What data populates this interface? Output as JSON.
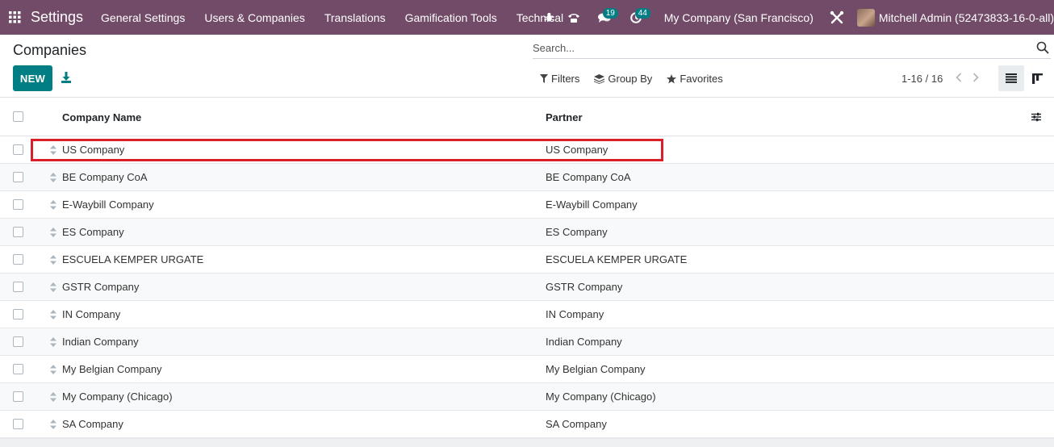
{
  "navbar": {
    "app_name": "Settings",
    "menu": [
      "General Settings",
      "Users & Companies",
      "Translations",
      "Gamification Tools",
      "Technical"
    ],
    "messages_badge": "19",
    "activities_badge": "44",
    "company": "My Company (San Francisco)",
    "user": "Mitchell Admin (52473833-16-0-all)",
    "icons": [
      "apps-grid-icon",
      "bug-icon",
      "phone-icon",
      "chat-icon",
      "clock-icon",
      "tools-icon",
      "avatar"
    ]
  },
  "control_panel": {
    "breadcrumb": "Companies",
    "search_placeholder": "Search...",
    "new_label": "NEW",
    "filters_label": "Filters",
    "group_by_label": "Group By",
    "favorites_label": "Favorites",
    "pager": "1-16 / 16"
  },
  "list": {
    "columns": {
      "name": "Company Name",
      "partner": "Partner"
    },
    "rows": [
      {
        "name": "US Company",
        "partner": "US Company"
      },
      {
        "name": "BE Company CoA",
        "partner": "BE Company CoA"
      },
      {
        "name": "E-Waybill Company",
        "partner": "E-Waybill Company"
      },
      {
        "name": "ES Company",
        "partner": "ES Company"
      },
      {
        "name": "ESCUELA KEMPER URGATE",
        "partner": "ESCUELA KEMPER URGATE"
      },
      {
        "name": "GSTR Company",
        "partner": "GSTR Company"
      },
      {
        "name": "IN Company",
        "partner": "IN Company"
      },
      {
        "name": "Indian Company",
        "partner": "Indian Company"
      },
      {
        "name": "My Belgian Company",
        "partner": "My Belgian Company"
      },
      {
        "name": "My Company (Chicago)",
        "partner": "My Company (Chicago)"
      },
      {
        "name": "SA Company",
        "partner": "SA Company"
      }
    ]
  },
  "colors": {
    "brand": "#714b67",
    "primary": "#017e84",
    "highlight": "#d81f2a"
  }
}
